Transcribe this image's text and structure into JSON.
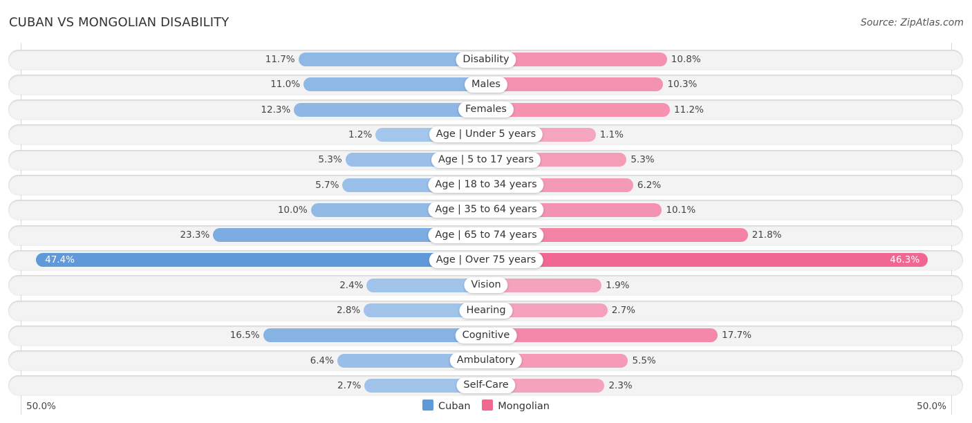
{
  "header": {
    "title": "CUBAN VS MONGOLIAN DISABILITY",
    "source": "Source: ZipAtlas.com"
  },
  "chart_data": {
    "type": "bar",
    "orientation": "horizontal-diverging",
    "title": "CUBAN VS MONGOLIAN DISABILITY",
    "categories": [
      "Disability",
      "Males",
      "Females",
      "Age | Under 5 years",
      "Age | 5 to 17 years",
      "Age | 18 to 34 years",
      "Age | 35 to 64 years",
      "Age | 65 to 74 years",
      "Age | Over 75 years",
      "Vision",
      "Hearing",
      "Cognitive",
      "Ambulatory",
      "Self-Care"
    ],
    "series": [
      {
        "name": "Cuban",
        "side": "left",
        "color": "#6099d9",
        "light_color": "#abcaed",
        "values": [
          11.7,
          11.0,
          12.3,
          1.2,
          5.3,
          5.7,
          10.0,
          23.3,
          47.4,
          2.4,
          2.8,
          16.5,
          6.4,
          2.7
        ],
        "labels": [
          "11.7%",
          "11.0%",
          "12.3%",
          "1.2%",
          "5.3%",
          "5.7%",
          "10.0%",
          "23.3%",
          "47.4%",
          "2.4%",
          "2.8%",
          "16.5%",
          "6.4%",
          "2.7%"
        ]
      },
      {
        "name": "Mongolian",
        "side": "right",
        "color": "#f06790",
        "light_color": "#f6aac2",
        "values": [
          10.8,
          10.3,
          11.2,
          1.1,
          5.3,
          6.2,
          10.1,
          21.8,
          46.3,
          1.9,
          2.7,
          17.7,
          5.5,
          2.3
        ],
        "labels": [
          "10.8%",
          "10.3%",
          "11.2%",
          "1.1%",
          "5.3%",
          "6.2%",
          "10.1%",
          "21.8%",
          "46.3%",
          "1.9%",
          "2.7%",
          "17.7%",
          "5.5%",
          "2.3%"
        ]
      }
    ],
    "xlim": [
      -50,
      50
    ],
    "axis_labels": {
      "left": "50.0%",
      "right": "50.0%"
    },
    "legend": {
      "position": "bottom-center",
      "entries": [
        "Cuban",
        "Mongolian"
      ]
    },
    "grid": false
  }
}
